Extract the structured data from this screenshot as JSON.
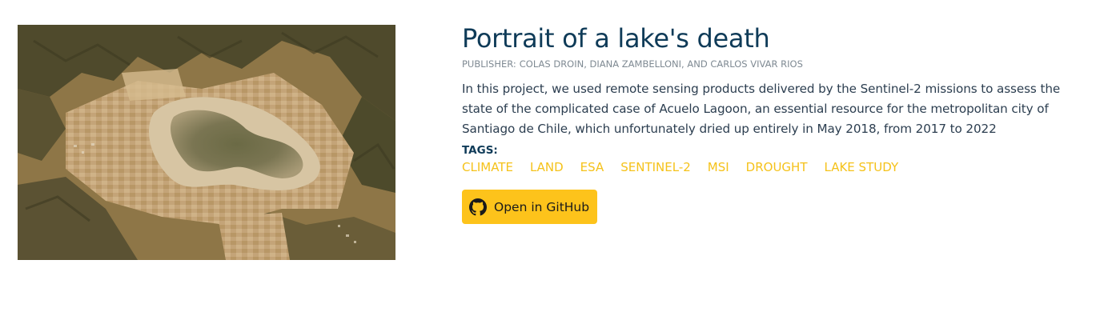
{
  "project": {
    "title": "Portrait of a lake's death",
    "publisher_prefix": "PUBLISHER:",
    "publisher_names": "COLAS DROIN, DIANA ZAMBELLONI, AND CARLOS VIVAR RIOS",
    "description": "In this project, we used remote sensing products delivered by the Sentinel-2 missions to assess the state of the complicated case of Acuelo Lagoon, an essential resource for the metropolitan city of Santiago de Chile, which unfortunately dried up entirely in May 2018, from 2017 to 2022",
    "tags_label": "TAGS:",
    "tags": [
      "CLIMATE",
      "LAND",
      "ESA",
      "SENTINEL-2",
      "MSI",
      "DROUGHT",
      "LAKE STUDY"
    ],
    "github_button": {
      "label": "Open in GitHub",
      "icon": "github-icon"
    }
  },
  "colors": {
    "title": "#0f3b58",
    "tag": "#f5c21a",
    "button_bg": "#fdc31b"
  }
}
